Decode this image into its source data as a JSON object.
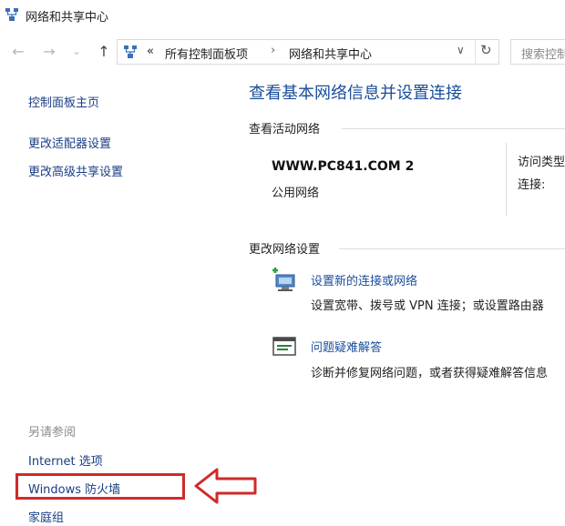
{
  "window": {
    "title": "网络和共享中心"
  },
  "address_bar": {
    "overflow": "«",
    "crumbs": [
      "所有控制面板项",
      "网络和共享中心"
    ],
    "separator": "›",
    "search_placeholder": "搜索控制"
  },
  "left_pane": {
    "home": "控制面板主页",
    "links": [
      "更改适配器设置",
      "更改高级共享设置"
    ],
    "see_also": {
      "heading": "另请参阅",
      "items": [
        "Internet 选项",
        "Windows 防火墙",
        "家庭组"
      ]
    }
  },
  "main": {
    "title": "查看基本网络信息并设置连接",
    "active_networks": {
      "heading": "查看活动网络",
      "name": "WWW.PC841.COM  2",
      "type": "公用网络",
      "access_type_label": "访问类型:",
      "connections_label": "连接:"
    },
    "change_settings": {
      "heading": "更改网络设置",
      "tasks": [
        {
          "link": "设置新的连接或网络",
          "desc": "设置宽带、拨号或 VPN 连接；或设置路由器"
        },
        {
          "link": "问题疑难解答",
          "desc": "诊断并修复网络问题，或者获得疑难解答信息"
        }
      ]
    }
  },
  "colors": {
    "link": "#1a4e9c",
    "highlight": "#cf2a2a"
  }
}
